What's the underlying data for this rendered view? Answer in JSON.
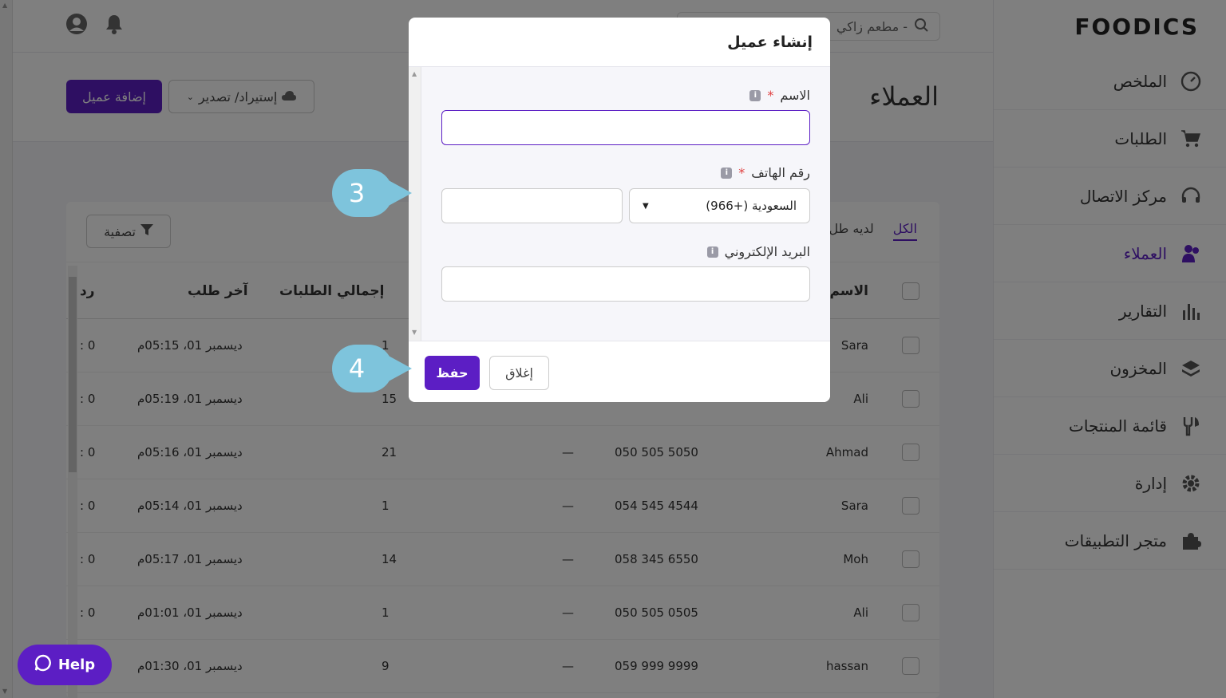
{
  "brand": {
    "logo": "FOODICS",
    "accent": "#5c1ec4"
  },
  "header": {
    "search_placeholder": "مطعم زاكي -"
  },
  "page": {
    "title": "العملاء",
    "add_button": "إضافة عميل",
    "import_button": "إستيراد/ تصدير"
  },
  "sidebar": {
    "items": [
      {
        "label": "الملخص",
        "icon": "dashboard-icon"
      },
      {
        "label": "الطلبات",
        "icon": "cart-icon"
      },
      {
        "label": "مركز الاتصال",
        "icon": "headset-icon"
      },
      {
        "label": "العملاء",
        "icon": "users-icon",
        "active": true
      },
      {
        "label": "التقارير",
        "icon": "chart-icon"
      },
      {
        "label": "المخزون",
        "icon": "layers-icon"
      },
      {
        "label": "قائمة المنتجات",
        "icon": "utensils-icon"
      },
      {
        "label": "إدارة",
        "icon": "gear-icon"
      },
      {
        "label": "متجر التطبيقات",
        "icon": "puzzle-icon"
      }
    ]
  },
  "table": {
    "tabs": [
      "الكل",
      "لديه طل"
    ],
    "filter_button": "تصفية",
    "headers": {
      "name": "الاسم",
      "total_orders": "إجمالي الطلبات",
      "last_order": "آخر طلب",
      "balance": "رد"
    },
    "rows": [
      {
        "name": "Sara",
        "phone": "",
        "email": "",
        "orders": "1",
        "last": "ديسمبر 01، 05:15م",
        "bal": ": 0"
      },
      {
        "name": "Ali",
        "phone": "",
        "email": "",
        "orders": "15",
        "last": "ديسمبر 01، 05:19م",
        "bal": ": 0"
      },
      {
        "name": "Ahmad",
        "phone": "050 505 5050",
        "email": "—",
        "orders": "21",
        "last": "ديسمبر 01، 05:16م",
        "bal": ": 0"
      },
      {
        "name": "Sara",
        "phone": "054 545 4544",
        "email": "—",
        "orders": "1",
        "last": "ديسمبر 01، 05:14م",
        "bal": ": 0"
      },
      {
        "name": "Moh",
        "phone": "058 345 6550",
        "email": "—",
        "orders": "14",
        "last": "ديسمبر 01، 05:17م",
        "bal": ": 0"
      },
      {
        "name": "Ali",
        "phone": "050 505 0505",
        "email": "—",
        "orders": "1",
        "last": "ديسمبر 01، 01:01م",
        "bal": ": 0"
      },
      {
        "name": "hassan",
        "phone": "059 999 9999",
        "email": "—",
        "orders": "9",
        "last": "ديسمبر 01، 01:30م",
        "bal": ""
      }
    ]
  },
  "modal": {
    "title": "إنشاء عميل",
    "name_label": "الاسم",
    "phone_label": "رقم الهاتف",
    "email_label": "البريد الإلكتروني",
    "required_mark": "*",
    "country_value": "السعودية (+966)",
    "save_button": "حفظ",
    "close_button": "إغلاق"
  },
  "callouts": {
    "step3": "3",
    "step4": "4"
  },
  "help": {
    "label": "Help"
  }
}
